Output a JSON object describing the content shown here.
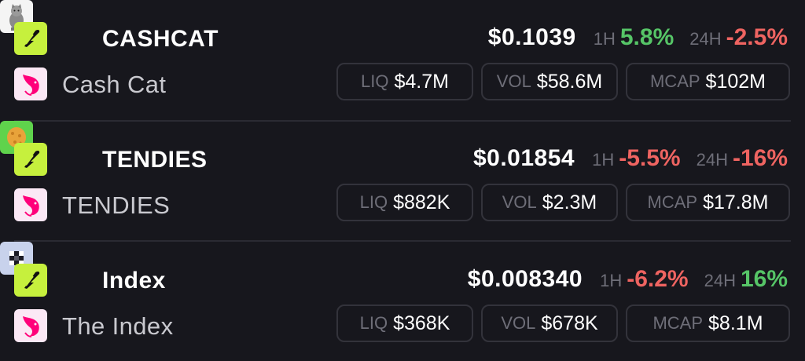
{
  "labels": {
    "h1": "1H",
    "h24": "24H",
    "liq": "LIQ",
    "vol": "VOL",
    "mcap": "MCAP"
  },
  "colors": {
    "positive": "#56c567",
    "negative": "#ef6461",
    "dex_badge": "#c6f03d",
    "uniswap_badge": "#fbe8f5",
    "uniswap_pink": "#ff007a"
  },
  "tokens": [
    {
      "symbol": "CASHCAT",
      "name": "Cash Cat",
      "icon": "cat-icon",
      "price": "$0.1039",
      "change_1h": "5.8%",
      "change_1h_direction": "up",
      "change_24h": "-2.5%",
      "change_24h_direction": "down",
      "liq": "$4.7M",
      "vol": "$58.6M",
      "mcap": "$102M"
    },
    {
      "symbol": "TENDIES",
      "name": "TENDIES",
      "icon": "chicken-nugget-icon",
      "price": "$0.01854",
      "change_1h": "-5.5%",
      "change_1h_direction": "down",
      "change_24h": "-16%",
      "change_24h_direction": "down",
      "liq": "$882K",
      "vol": "$2.3M",
      "mcap": "$17.8M"
    },
    {
      "symbol": "Index",
      "name": "The Index",
      "icon": "index-logo-icon",
      "price": "$0.008340",
      "change_1h": "-6.2%",
      "change_1h_direction": "down",
      "change_24h": "16%",
      "change_24h_direction": "up",
      "liq": "$368K",
      "vol": "$678K",
      "mcap": "$8.1M"
    }
  ]
}
